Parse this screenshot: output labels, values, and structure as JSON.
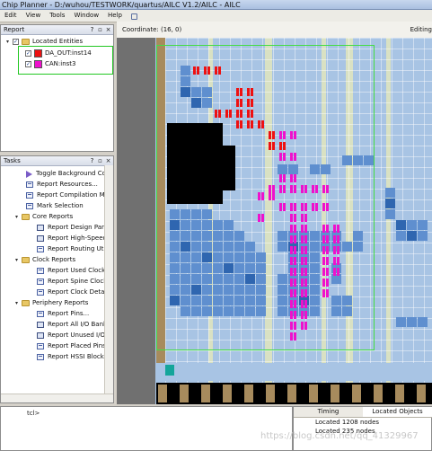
{
  "window": {
    "title": "Chip Planner - D:/wuhou/TESTWORK/quartus/AILC V1.2/AILC - AILC"
  },
  "menubar": {
    "items": [
      "Edit",
      "View",
      "Tools",
      "Window",
      "Help"
    ]
  },
  "report_panel": {
    "title": "Report",
    "root_label": "Located Entities",
    "entities": [
      {
        "label": "DA_OUT:inst14",
        "color": "#ee1111"
      },
      {
        "label": "CAN:inst3",
        "color": "#ee11cc"
      }
    ]
  },
  "tasks_panel": {
    "title": "Tasks",
    "items": [
      {
        "label": "Toggle Background Colors",
        "icon": "toggle-icon",
        "level": 1
      },
      {
        "label": "Report Resources...",
        "icon": "report-icon",
        "level": 1
      },
      {
        "label": "Report Compilation Messages",
        "icon": "report-icon",
        "level": 1
      },
      {
        "label": "Mark Selection",
        "icon": "report-icon",
        "level": 1
      },
      {
        "label": "Core Reports",
        "icon": "folder-icon",
        "level": 0
      },
      {
        "label": "Report Design Partitions",
        "icon": "table-icon",
        "level": 2
      },
      {
        "label": "Report High-Speed/Low-Power Tiles",
        "icon": "table-icon",
        "level": 2
      },
      {
        "label": "Report Routing Utilization",
        "icon": "report-icon",
        "level": 2
      },
      {
        "label": "Clock Reports",
        "icon": "folder-icon",
        "level": 0
      },
      {
        "label": "Report Used Clock Regions",
        "icon": "report-icon",
        "level": 2
      },
      {
        "label": "Report Spine Clock Utilization",
        "icon": "report-icon",
        "level": 2
      },
      {
        "label": "Report Clock Details...",
        "icon": "report-icon",
        "level": 2
      },
      {
        "label": "Periphery Reports",
        "icon": "folder-icon",
        "level": 0
      },
      {
        "label": "Report Pins...",
        "icon": "report-icon",
        "level": 2
      },
      {
        "label": "Report All I/O Banks",
        "icon": "table-icon",
        "level": 2
      },
      {
        "label": "Report Unused I/O Pins",
        "icon": "table-icon",
        "level": 2
      },
      {
        "label": "Report Placed Pins By I/O Bank",
        "icon": "report-icon",
        "level": 2
      },
      {
        "label": "Report HSSI Block Connectivity",
        "icon": "report-icon",
        "level": 2
      }
    ]
  },
  "chip_planner": {
    "coordinate_label": "Coordinate: (16, 0)",
    "mode_label": "Editing"
  },
  "tcl": {
    "prompt": "tcl>"
  },
  "messages": {
    "tabs": [
      "Timing",
      "Located Objects"
    ],
    "lines": [
      "Located 1208 nodes",
      "Located 235 nodes"
    ]
  },
  "watermark": "https://blog.csdn.net/qq_41329967"
}
